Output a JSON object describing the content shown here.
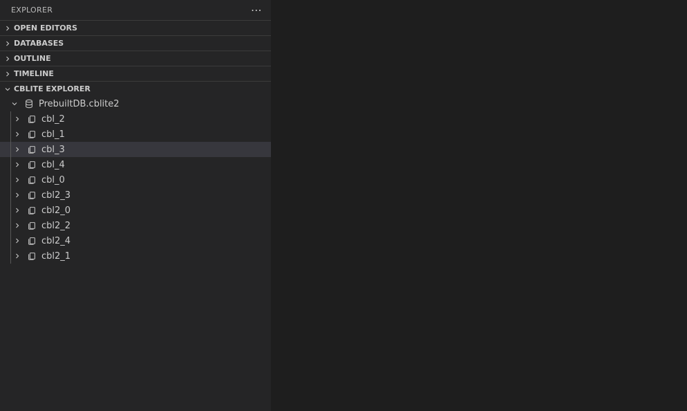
{
  "panel": {
    "title": "EXPLORER"
  },
  "sections": [
    {
      "label": "OPEN EDITORS",
      "expanded": false
    },
    {
      "label": "DATABASES",
      "expanded": false
    },
    {
      "label": "OUTLINE",
      "expanded": false
    },
    {
      "label": "TIMELINE",
      "expanded": false
    },
    {
      "label": "CBLITE EXPLORER",
      "expanded": true
    }
  ],
  "cblite": {
    "database": {
      "name": "PrebuiltDB.cblite2",
      "expanded": true
    },
    "items": [
      {
        "label": "cbl_2",
        "selected": false
      },
      {
        "label": "cbl_1",
        "selected": false
      },
      {
        "label": "cbl_3",
        "selected": true
      },
      {
        "label": "cbl_4",
        "selected": false
      },
      {
        "label": "cbl_0",
        "selected": false
      },
      {
        "label": "cbl2_3",
        "selected": false
      },
      {
        "label": "cbl2_0",
        "selected": false
      },
      {
        "label": "cbl2_2",
        "selected": false
      },
      {
        "label": "cbl2_4",
        "selected": false
      },
      {
        "label": "cbl2_1",
        "selected": false
      }
    ]
  }
}
